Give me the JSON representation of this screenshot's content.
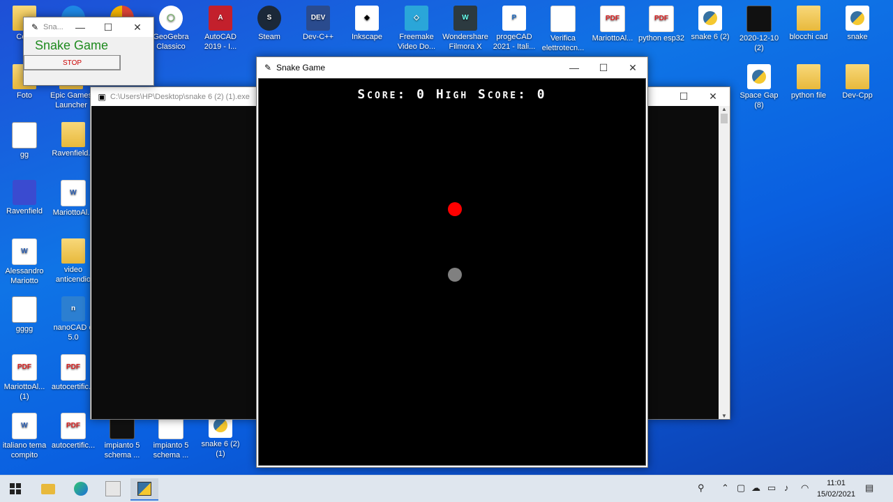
{
  "desktop_icons": [
    {
      "label": "Ce...",
      "kind": "folder"
    },
    {
      "label": "",
      "kind": "edge"
    },
    {
      "label": "",
      "kind": "chrome"
    },
    {
      "label": "GeoGebra Classico",
      "kind": "geo",
      "glyph": "◯"
    },
    {
      "label": "AutoCAD 2019 - I...",
      "kind": "autocad",
      "glyph": "A"
    },
    {
      "label": "Steam",
      "kind": "steam",
      "glyph": "S"
    },
    {
      "label": "Dev-C++",
      "kind": "dev",
      "glyph": "DEV"
    },
    {
      "label": "Inkscape",
      "kind": "ink",
      "glyph": "◆"
    },
    {
      "label": "Freemake Video Do...",
      "kind": "free",
      "glyph": "◇"
    },
    {
      "label": "Wondershare Filmora X",
      "kind": "won",
      "glyph": "W"
    },
    {
      "label": "progeCAD 2021 - Itali...",
      "kind": "proge",
      "glyph": "P"
    },
    {
      "label": "Verifica elettrotecn...",
      "kind": "doc",
      "glyph": ""
    },
    {
      "label": "MariottoAl...",
      "kind": "pdf",
      "glyph": "PDF"
    },
    {
      "label": "python esp32",
      "kind": "pdf",
      "glyph": "PDF"
    },
    {
      "label": "snake 6 (2)",
      "kind": "py",
      "glyph": ""
    },
    {
      "label": "2020-12-10 (2)",
      "kind": "dark",
      "glyph": ""
    },
    {
      "label": "blocchi cad",
      "kind": "folder",
      "glyph": ""
    },
    {
      "label": "snake",
      "kind": "py",
      "glyph": ""
    },
    {
      "label": "Foto",
      "kind": "folder",
      "glyph": ""
    },
    {
      "label": "Epic Games Launcher",
      "kind": "folder",
      "glyph": ""
    },
    {
      "label": "Space Gap (8)",
      "kind": "py",
      "glyph": ""
    },
    {
      "label": "python file",
      "kind": "folder",
      "glyph": ""
    },
    {
      "label": "Dev-Cpp",
      "kind": "folder",
      "glyph": ""
    },
    {
      "label": "gg",
      "kind": "gg",
      "glyph": ""
    },
    {
      "label": "Ravenfield...",
      "kind": "folder",
      "glyph": ""
    },
    {
      "label": "Ravenfield",
      "kind": "raven",
      "glyph": ""
    },
    {
      "label": "MariottoAl...",
      "kind": "word",
      "glyph": "W"
    },
    {
      "label": "Alessandro Mariotto",
      "kind": "word",
      "glyph": "W"
    },
    {
      "label": "video anticendio",
      "kind": "folder",
      "glyph": ""
    },
    {
      "label": "gggg",
      "kind": "gg",
      "glyph": ""
    },
    {
      "label": "nanoCAD e 5.0",
      "kind": "nano",
      "glyph": "n"
    },
    {
      "label": "MariottoAl... (1)",
      "kind": "pdf",
      "glyph": "PDF"
    },
    {
      "label": "autocertific...",
      "kind": "pdf",
      "glyph": "PDF"
    },
    {
      "label": "italiano tema compito",
      "kind": "word",
      "glyph": "W"
    },
    {
      "label": "autocertific...",
      "kind": "pdf",
      "glyph": "PDF"
    },
    {
      "label": "impianto 5 schema ...",
      "kind": "dark",
      "glyph": ""
    },
    {
      "label": "impianto 5 schema ...",
      "kind": "doc",
      "glyph": ""
    },
    {
      "label": "snake 6 (2) (1)",
      "kind": "py",
      "glyph": ""
    }
  ],
  "small_window": {
    "title": "Sna...",
    "heading": "Snake Game",
    "stop_label": "STOP"
  },
  "console_window": {
    "title": "C:\\Users\\HP\\Desktop\\snake 6 (2) (1).exe"
  },
  "main_window": {
    "title": "Snake Game",
    "score_text": "Score: 0  High Score: 0",
    "food_color": "#ff0000",
    "snake_color": "#808080"
  },
  "taskbar": {
    "time": "11:01",
    "date": "15/02/2021"
  }
}
